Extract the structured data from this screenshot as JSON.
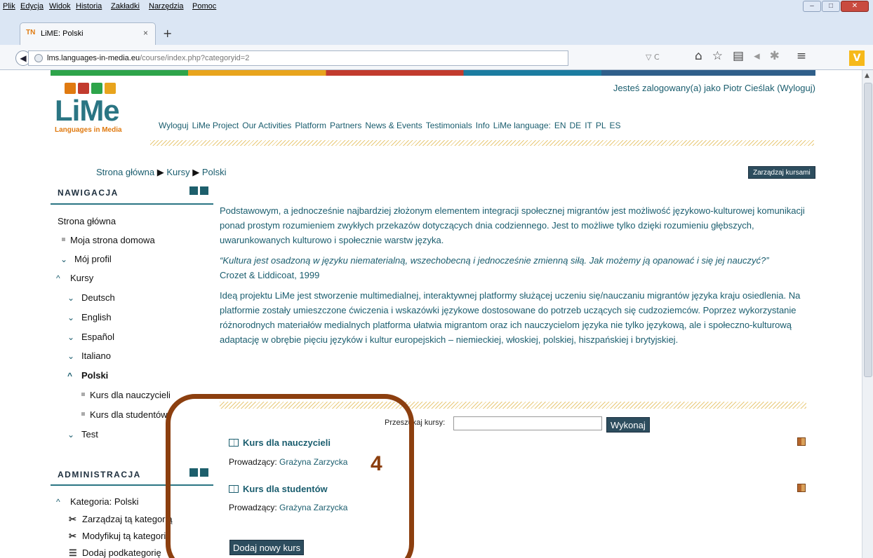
{
  "menubar": [
    "Plik",
    "Edycja",
    "Widok",
    "Historia",
    "Zakładki",
    "Narzędzia",
    "Pomoc"
  ],
  "tab": {
    "title": "LiME: Polski",
    "favicon": "LiMe-favicon",
    "close": "×",
    "new": "+"
  },
  "url": {
    "host": "lms.languages-in-media.eu",
    "path": "/course/index.php?categoryid=2"
  },
  "toolbar_icons": [
    "reload-icon",
    "home-icon",
    "bookmark-star-icon",
    "reading-list-icon",
    "send-icon",
    "extension-icon",
    "menu-icon"
  ],
  "logo": {
    "big": "LiMe",
    "sub": "Languages in Media"
  },
  "logged_in": "Jesteś zalogowany(a) jako Piotr Cieślak (Wyloguj)",
  "topnav": [
    "Wyloguj",
    "LiMe Project",
    "Our Activities",
    "Platform",
    "Partners",
    "News & Events",
    "Testimonials",
    "Info",
    "LiMe language:",
    "EN",
    "DE",
    "IT",
    "PL",
    "ES"
  ],
  "breadcrumb": {
    "home": "Strona główna",
    "courses": "Kursy",
    "current": "Polski"
  },
  "manage_courses": "Zarządzaj kursami",
  "nav": {
    "header": "NAWIGACJA",
    "items": [
      {
        "label": "Strona główna",
        "marker": ""
      },
      {
        "label": "Moja strona domowa",
        "marker": "square"
      },
      {
        "label": "Mój profil",
        "marker": "down"
      },
      {
        "label": "Kursy",
        "marker": "up"
      },
      {
        "label": "Deutsch",
        "marker": "down"
      },
      {
        "label": "English",
        "marker": "down"
      },
      {
        "label": "Español",
        "marker": "down"
      },
      {
        "label": "Italiano",
        "marker": "down"
      },
      {
        "label": "Polski",
        "marker": "up"
      },
      {
        "label": "Kurs dla nauczycieli",
        "marker": "square"
      },
      {
        "label": "Kurs dla studentów",
        "marker": "square"
      },
      {
        "label": "Test",
        "marker": "down"
      }
    ]
  },
  "admin": {
    "header": "ADMINISTRACJA",
    "category": "Kategoria: Polski",
    "items": [
      "Zarządzaj tą kategorią",
      "Modyfikuj tą kategorię",
      "Dodaj podkategorię"
    ]
  },
  "description": {
    "p1": "Podstawowym, a jednocześnie najbardziej złożonym elementem integracji społecznej migrantów jest możliwość językowo-kulturowej komunikacji ponad prostym rozumieniem zwykłych przekazów dotyczących dnia codziennego. Jest to możliwe tylko dzięki rozumieniu głębszych, uwarunkowanych kulturowo i społecznie warstw języka.",
    "quote": "“Kultura jest osadzoną w języku niematerialną, wszechobecną i jednocześnie zmienną siłą. Jak możemy ją opanować i się jej nauczyć?”",
    "cite": "Crozet & Liddicoat, 1999",
    "p2": "Ideą projektu LiMe jest stworzenie multimedialnej, interaktywnej platformy służącej uczeniu się/nauczaniu migrantów języka kraju osiedlenia. Na platformie zostały umieszczone ćwiczenia i wskazówki językowe dostosowane do potrzeb uczących się cudzoziemców. Poprzez wykorzystanie różnorodnych materiałów medialnych platforma ułatwia migrantom oraz ich nauczycielom języka nie tylko językową, ale i społeczno-kulturową adaptację w obrębie pięciu języków i kultur europejskich – niemieckiej, włoskiej, polskiej, hiszpańskiej i brytyjskiej."
  },
  "search": {
    "label": "Przeszukaj kursy:",
    "button": "Wykonaj",
    "value": ""
  },
  "courses": [
    {
      "name": "Kurs dla nauczycieli",
      "teacher_label": "Prowadzący:",
      "teacher": "Grażyna Zarzycka"
    },
    {
      "name": "Kurs dla studentów",
      "teacher_label": "Prowadzący:",
      "teacher": "Grażyna Zarzycka"
    }
  ],
  "add_course": "Dodaj nowy kurs",
  "annotation": {
    "number": "4",
    "color": "#8c3f0f"
  },
  "colors": {
    "accent": "#1a5d6e",
    "button": "#2d4d5e",
    "logo_orange": "#e07a10"
  }
}
